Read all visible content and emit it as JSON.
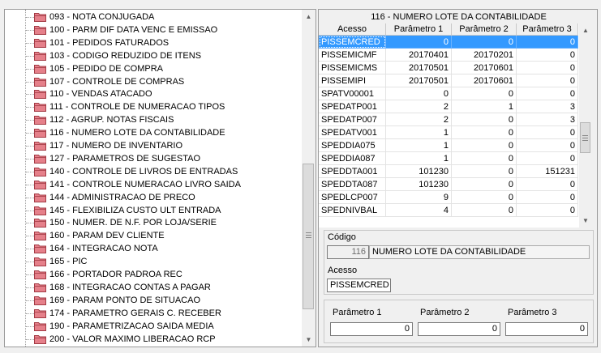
{
  "tree": {
    "items": [
      {
        "label": "093 - NOTA CONJUGADA"
      },
      {
        "label": "100 - PARM DIF DATA VENC E EMISSAO"
      },
      {
        "label": "101 - PEDIDOS FATURADOS"
      },
      {
        "label": "103 - CODIGO REDUZIDO DE ITENS"
      },
      {
        "label": "105 - PEDIDO DE COMPRA"
      },
      {
        "label": "107 - CONTROLE DE COMPRAS"
      },
      {
        "label": "110 - VENDAS ATACADO"
      },
      {
        "label": "111 - CONTROLE DE NUMERACAO TIPOS"
      },
      {
        "label": "112 - AGRUP. NOTAS FISCAIS"
      },
      {
        "label": "116 - NUMERO LOTE DA CONTABILIDADE"
      },
      {
        "label": "117 - NUMERO DE INVENTARIO"
      },
      {
        "label": "127 - PARAMETROS DE SUGESTAO"
      },
      {
        "label": "140 - CONTROLE DE LIVROS DE ENTRADAS"
      },
      {
        "label": "141 - CONTROLE NUMERACAO LIVRO SAIDA"
      },
      {
        "label": "144 - ADMINISTRACAO DE PRECO"
      },
      {
        "label": "145 - FLEXIBILIZA CUSTO ULT ENTRADA"
      },
      {
        "label": "150 - NUMER. DE N.F. POR LOJA/SERIE"
      },
      {
        "label": "160 - PARAM DEV CLIENTE"
      },
      {
        "label": "164 - INTEGRACAO NOTA"
      },
      {
        "label": "165 - PIC"
      },
      {
        "label": "166 - PORTADOR PADROA REC"
      },
      {
        "label": "168 - INTEGRACAO CONTAS A PAGAR"
      },
      {
        "label": "169 - PARAM PONTO DE SITUACAO"
      },
      {
        "label": "174 - PARAMETRO GERAIS C. RECEBER"
      },
      {
        "label": "190 - PARAMETRIZACAO SAIDA MEDIA"
      },
      {
        "label": "200 - VALOR MAXIMO LIBERACAO RCP"
      }
    ]
  },
  "grid": {
    "title": "116 - NUMERO LOTE DA CONTABILIDADE",
    "columns": [
      "Acesso",
      "Parâmetro 1",
      "Parâmetro 2",
      "Parâmetro 3"
    ],
    "selected_row": 0,
    "rows": [
      [
        "PISSEMCRED",
        "0",
        "0",
        "0"
      ],
      [
        "PISSEMICMF",
        "20170401",
        "20170201",
        "0"
      ],
      [
        "PISSEMICMS",
        "20170501",
        "20170601",
        "0"
      ],
      [
        "PISSEMIPI",
        "20170501",
        "20170601",
        "0"
      ],
      [
        "SPATV00001",
        "0",
        "0",
        "0"
      ],
      [
        "SPEDATP001",
        "2",
        "1",
        "3"
      ],
      [
        "SPEDATP007",
        "2",
        "0",
        "3"
      ],
      [
        "SPEDATV001",
        "1",
        "0",
        "0"
      ],
      [
        "SPEDDIA075",
        "1",
        "0",
        "0"
      ],
      [
        "SPEDDIA087",
        "1",
        "0",
        "0"
      ],
      [
        "SPEDDTA001",
        "101230",
        "0",
        "151231"
      ],
      [
        "SPEDDTA087",
        "101230",
        "0",
        "0"
      ],
      [
        "SPEDLCP007",
        "9",
        "0",
        "0"
      ],
      [
        "SPEDNIVBAL",
        "4",
        "0",
        "0"
      ]
    ]
  },
  "form": {
    "codigo_label": "Código",
    "codigo_value": "116",
    "codigo_desc": "NUMERO LOTE DA CONTABILIDADE",
    "acesso_label": "Acesso",
    "acesso_value": "PISSEMCRED",
    "param1_label": "Parâmetro 1",
    "param1_value": "0",
    "param2_label": "Parâmetro 2",
    "param2_value": "0",
    "param3_label": "Parâmetro 3",
    "param3_value": "0"
  },
  "colors": {
    "selection": "#3399ff",
    "folder_fill": "#e5808a",
    "folder_stroke": "#a33a44"
  },
  "icons": {
    "tree_item": "folder-icon",
    "scroll_up": "arrow-up-icon",
    "scroll_down": "arrow-down-icon"
  }
}
